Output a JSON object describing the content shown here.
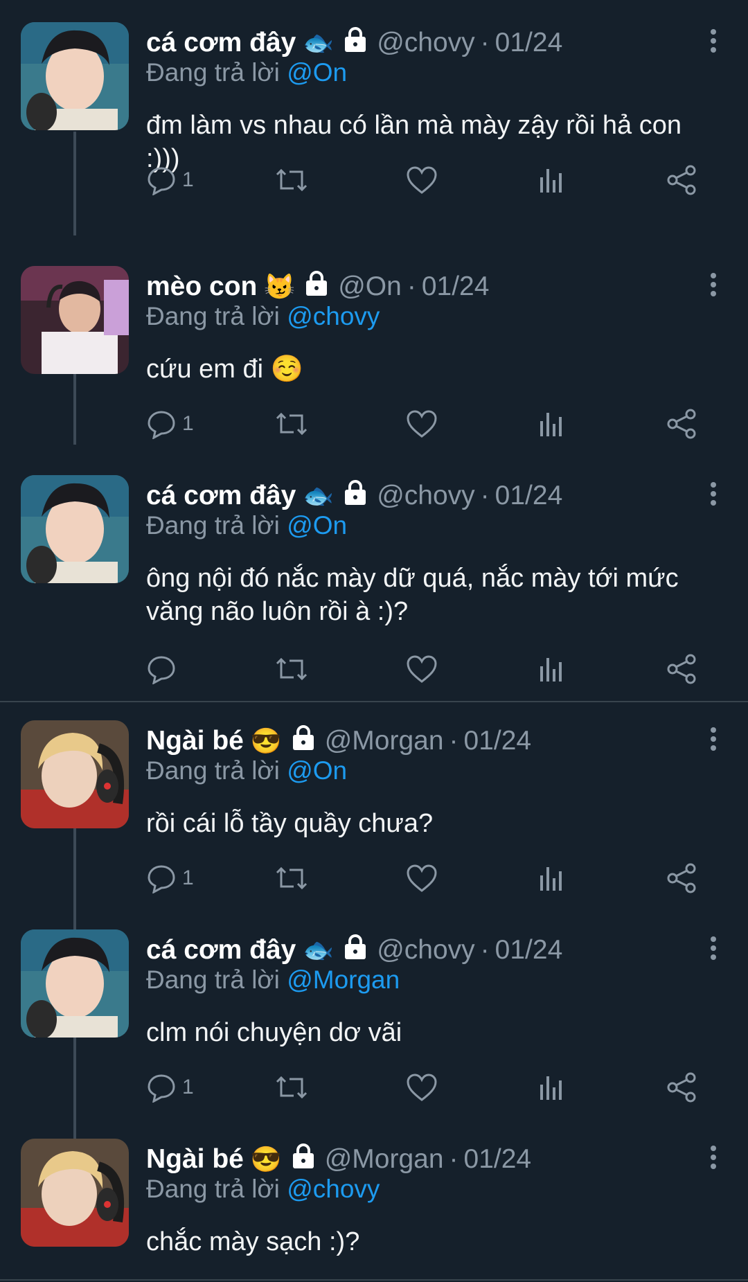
{
  "colors": {
    "background": "#15202b",
    "text": "#ffffff",
    "muted": "#8b98a5",
    "mention": "#1d9bf0"
  },
  "tweets": [
    {
      "name": "cá cơm đây",
      "emoji": "🐟",
      "handle": "@chovy",
      "date": "01/24",
      "replying_label": "Đang trả lời",
      "replying_to": "@On",
      "text": "đm làm vs nhau có lần mà mày zậy rồi hả con :)))",
      "reply_count": "1",
      "avatar": "chovy-photo"
    },
    {
      "name": "mèo con",
      "emoji": "😼",
      "handle": "@On",
      "date": "01/24",
      "replying_label": "Đang trả lời",
      "replying_to": "@chovy",
      "text": "cứu em đi ☺️",
      "reply_count": "1",
      "avatar": "on-photo"
    },
    {
      "name": "cá cơm đây",
      "emoji": "🐟",
      "handle": "@chovy",
      "date": "01/24",
      "replying_label": "Đang trả lời",
      "replying_to": "@On",
      "text": "ông nội đó nắc mày dữ quá, nắc mày tới mức văng não luôn rồi à :)?",
      "reply_count": "",
      "avatar": "chovy-photo"
    },
    {
      "name": "Ngài bé",
      "emoji": "😎",
      "handle": "@Morgan",
      "date": "01/24",
      "replying_label": "Đang trả lời",
      "replying_to": "@On",
      "text": "rồi cái lỗ tầy quầy chưa?",
      "reply_count": "1",
      "avatar": "morgan-photo"
    },
    {
      "name": "cá cơm đây",
      "emoji": "🐟",
      "handle": "@chovy",
      "date": "01/24",
      "replying_label": "Đang trả lời",
      "replying_to": "@Morgan",
      "text": "clm nói chuyện dơ vãi",
      "reply_count": "1",
      "avatar": "chovy-photo"
    },
    {
      "name": "Ngài bé",
      "emoji": "😎",
      "handle": "@Morgan",
      "date": "01/24",
      "replying_label": "Đang trả lời",
      "replying_to": "@chovy",
      "text": "chắc mày sạch :)?",
      "reply_count": "",
      "avatar": "morgan-photo"
    }
  ]
}
